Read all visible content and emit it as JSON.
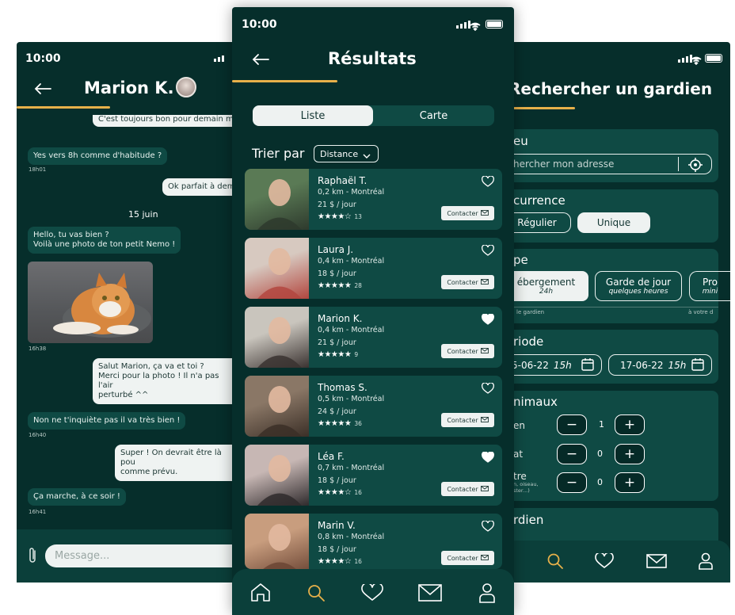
{
  "chat": {
    "status_time": "10:00",
    "title": "Marion K.",
    "messages": [
      {
        "text": "C'est toujours bon pour demain mo",
        "me": true,
        "time": ""
      },
      {
        "text": "Yes vers 8h comme d'habitude ?",
        "me": false,
        "time": "18h01"
      },
      {
        "text": "Ok parfait à dem",
        "me": true,
        "time": ""
      },
      {
        "text": "Hello, tu vas bien ?\nVoilà une photo de ton petit Nemo !",
        "me": false,
        "time": ""
      },
      {
        "text": "Salut Marion, ça va et toi ?\nMerci pour la photo ! Il n'a pas l'air\nperturbé ^^",
        "me": true,
        "time": ""
      },
      {
        "text": "Non ne t'inquiète pas il va très bien !",
        "me": false,
        "time": "16h40"
      },
      {
        "text": "Super ! On devrait être là pou\ncomme prévu.",
        "me": true,
        "time": ""
      },
      {
        "text": "Ça marche, à ce soir !",
        "me": false,
        "time": "16h41"
      }
    ],
    "day_label": "15 juin",
    "photo_time": "16h38",
    "input_placeholder": "Message..."
  },
  "results": {
    "status_time": "10:00",
    "title": "Résultats",
    "tabs": [
      "Liste",
      "Carte"
    ],
    "active_tab": "Liste",
    "sort_label": "Trier par",
    "sort_value": "Distance",
    "contact_label": "Contacter",
    "sitters": [
      {
        "name": "Raphaël T.",
        "distance": "0,2 km - Montréal",
        "price": "21 $ / jour",
        "stars": "★★★★☆",
        "reviews": "13",
        "favorite": false,
        "photo_colors": [
          "#5a7a55",
          "#2e3a2d"
        ]
      },
      {
        "name": "Laura J.",
        "distance": "0,4 km - Montréal",
        "price": "18 $ / jour",
        "stars": "★★★★★",
        "reviews": "28",
        "favorite": false,
        "photo_colors": [
          "#d7c9c0",
          "#b3473f"
        ]
      },
      {
        "name": "Marion K.",
        "distance": "0,4 km - Montréal",
        "price": "21 $ / jour",
        "stars": "★★★★★",
        "reviews": "9",
        "favorite": true,
        "photo_colors": [
          "#c9c5bd",
          "#3a3230"
        ]
      },
      {
        "name": "Thomas S.",
        "distance": "0,5 km - Montréal",
        "price": "24 $ / jour",
        "stars": "★★★★★",
        "reviews": "36",
        "favorite": false,
        "photo_colors": [
          "#8a7766",
          "#3b2f27"
        ]
      },
      {
        "name": "Léa F.",
        "distance": "0,7 km - Montréal",
        "price": "18 $ / jour",
        "stars": "★★★★☆",
        "reviews": "16",
        "favorite": true,
        "photo_colors": [
          "#c7b7b4",
          "#2f2a2c"
        ]
      },
      {
        "name": "Marin V.",
        "distance": "0,8 km - Montréal",
        "price": "18 $ / jour",
        "stars": "★★★★☆",
        "reviews": "16",
        "favorite": false,
        "photo_colors": [
          "#c89d7e",
          "#6b4534"
        ]
      }
    ]
  },
  "search": {
    "title": "Rechercher un gardien",
    "lieu_title": "eu",
    "address_placeholder": "hercher mon adresse",
    "occurrence_title": "currence",
    "occurrence_options": [
      "Régulier",
      "Unique"
    ],
    "type_title": "pe",
    "type_options": [
      {
        "label": "ébergement",
        "sub": "24h"
      },
      {
        "label": "Garde de jour",
        "sub": "quelques heures"
      },
      {
        "label": "Pro",
        "sub": "mini"
      }
    ],
    "type_captions": [
      "le gardien",
      "à votre d"
    ],
    "periode_title": "riode",
    "date_from": "5-06-22",
    "date_from_time": "15h",
    "date_to": "17-06-22",
    "date_to_time": "15h",
    "animaux_title": "nimaux",
    "animals": [
      {
        "label": "en",
        "count": "1"
      },
      {
        "label": "at",
        "count": "0"
      },
      {
        "label": "tre",
        "sublabel": "n, oiseau,\nster...)",
        "count": "0"
      }
    ],
    "gardien_title": "rdien"
  },
  "colors": {
    "background": "#062e2b",
    "card": "#0f4a44",
    "accent_gold": "#e7b04a",
    "light": "#eef2f1"
  }
}
